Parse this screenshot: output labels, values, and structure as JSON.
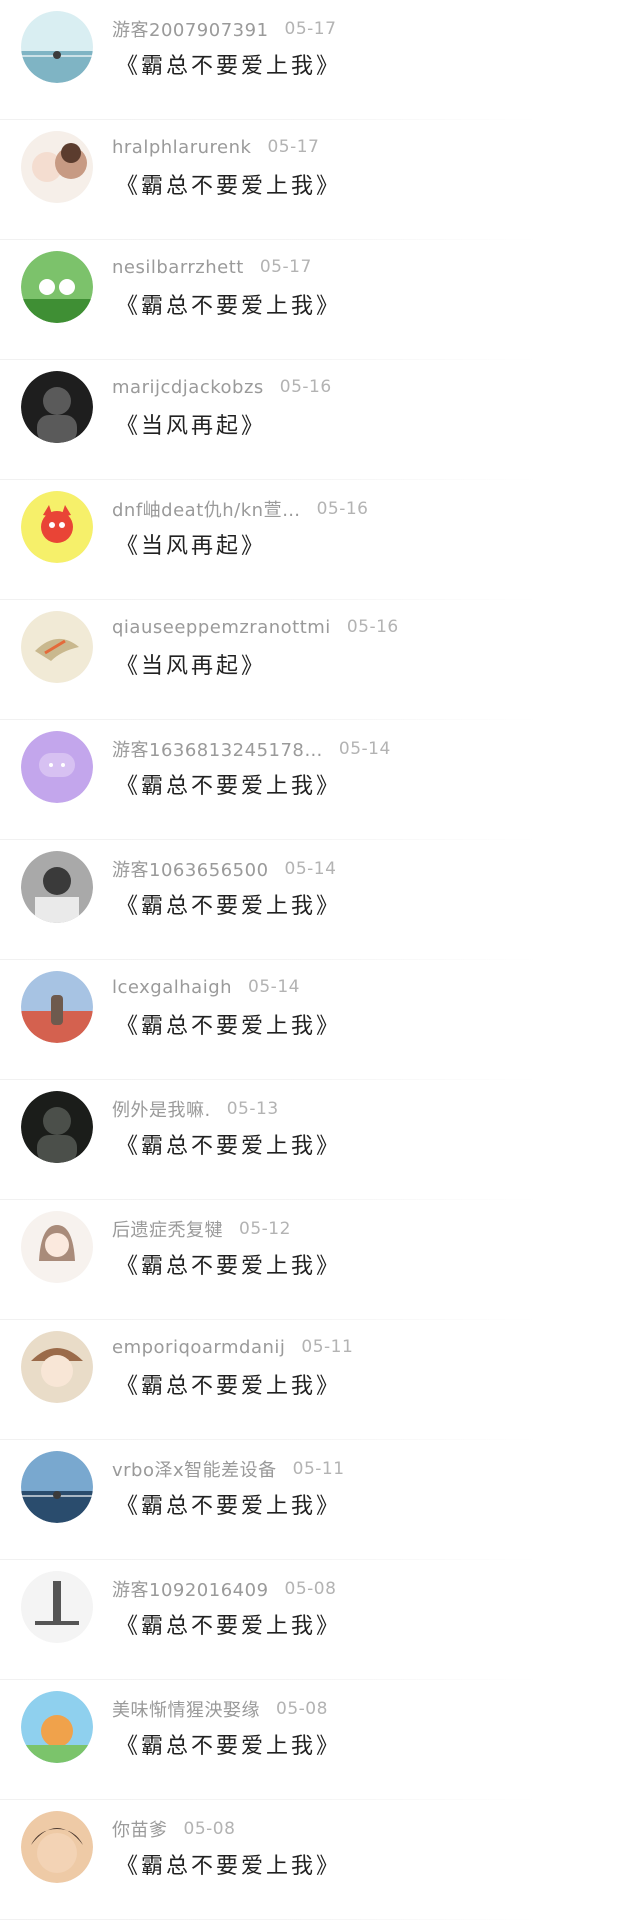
{
  "comments": [
    {
      "user": "游客2007907391",
      "date": "05-17",
      "book": "《霸总不要爱上我》",
      "avatar": {
        "c1": "#d9eef2",
        "c2": "#7fb4c4",
        "motif": "sea"
      }
    },
    {
      "user": "hralphlarurenk",
      "date": "05-17",
      "book": "《霸总不要爱上我》",
      "avatar": {
        "c1": "#f4ddd0",
        "c2": "#c79a83",
        "motif": "baby"
      }
    },
    {
      "user": "nesilbarrzhett",
      "date": "05-17",
      "book": "《霸总不要爱上我》",
      "avatar": {
        "c1": "#7cc26b",
        "c2": "#3f8f34",
        "motif": "grass"
      }
    },
    {
      "user": "marijcdjackobzs",
      "date": "05-16",
      "book": "《当风再起》",
      "avatar": {
        "c1": "#5a5a5a",
        "c2": "#1e1e1e",
        "motif": "dark"
      }
    },
    {
      "user": "dnf岫deat仇h/kn萱…",
      "date": "05-16",
      "book": "《当风再起》",
      "avatar": {
        "c1": "#f6f06a",
        "c2": "#e94436",
        "motif": "fox"
      }
    },
    {
      "user": "qiauseeppemzranottmi",
      "date": "05-16",
      "book": "《当风再起》",
      "avatar": {
        "c1": "#f1ead6",
        "c2": "#c9b88e",
        "motif": "bird"
      }
    },
    {
      "user": "游客1636813245178…",
      "date": "05-14",
      "book": "《霸总不要爱上我》",
      "avatar": {
        "c1": "#dcc8f4",
        "c2": "#c3a6ec",
        "motif": "bubble"
      }
    },
    {
      "user": "游客1063656500",
      "date": "05-14",
      "book": "《霸总不要爱上我》",
      "avatar": {
        "c1": "#a9a9a9",
        "c2": "#3a3a3a",
        "motif": "bw"
      }
    },
    {
      "user": "lcexgalhaigh",
      "date": "05-14",
      "book": "《霸总不要爱上我》",
      "avatar": {
        "c1": "#a7c3e3",
        "c2": "#d4614f",
        "motif": "flowers"
      }
    },
    {
      "user": "例外是我嘛.",
      "date": "05-13",
      "book": "《霸总不要爱上我》",
      "avatar": {
        "c1": "#4b4f4a",
        "c2": "#1b1d1a",
        "motif": "dark"
      }
    },
    {
      "user": "后遗症秃复犍",
      "date": "05-12",
      "book": "《霸总不要爱上我》",
      "avatar": {
        "c1": "#f7f2ee",
        "c2": "#a98b7a",
        "motif": "girl"
      }
    },
    {
      "user": "emporiqoarmdanij",
      "date": "05-11",
      "book": "《霸总不要爱上我》",
      "avatar": {
        "c1": "#e9dcc8",
        "c2": "#9b6b4a",
        "motif": "anime"
      }
    },
    {
      "user": "vrbo泽x智能差设备",
      "date": "05-11",
      "book": "《霸总不要爱上我》",
      "avatar": {
        "c1": "#79a8cf",
        "c2": "#2a4c6d",
        "motif": "sea"
      }
    },
    {
      "user": "游客1092016409",
      "date": "05-08",
      "book": "《霸总不要爱上我》",
      "avatar": {
        "c1": "#f4f4f4",
        "c2": "#555555",
        "motif": "sketch"
      }
    },
    {
      "user": "美味惭情猩泱娶缘",
      "date": "05-08",
      "book": "《霸总不要爱上我》",
      "avatar": {
        "c1": "#8fd0ee",
        "c2": "#f0a24b",
        "motif": "cartoon"
      }
    },
    {
      "user": "你苗爹",
      "date": "05-08",
      "book": "《霸总不要爱上我》",
      "avatar": {
        "c1": "#eecaa6",
        "c2": "#4d3a30",
        "motif": "child"
      }
    }
  ]
}
